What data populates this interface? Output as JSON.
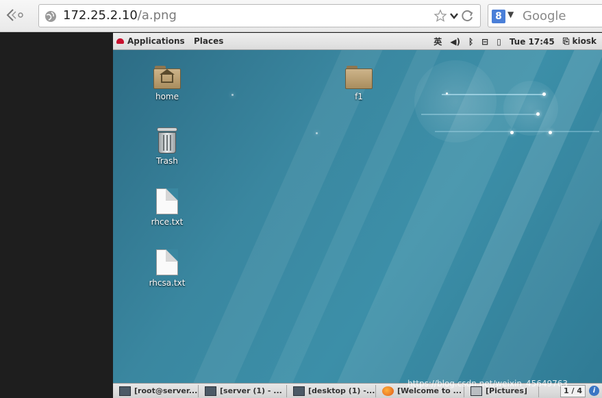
{
  "browser": {
    "url_host": "172.25.2.10",
    "url_path": "/a.png",
    "search_placeholder": "Google",
    "search_engine_letter": "8"
  },
  "remote": {
    "topbar": {
      "applications": "Applications",
      "places": "Places",
      "ime": "英",
      "clock": "Tue 17:45",
      "user": "kiosk"
    },
    "desktop_icons": [
      {
        "label": "home",
        "type": "home-folder"
      },
      {
        "label": "Trash",
        "type": "trash"
      },
      {
        "label": "rhce.txt",
        "type": "text-file"
      },
      {
        "label": "rhcsa.txt",
        "type": "text-file"
      },
      {
        "label": "f1",
        "type": "folder"
      }
    ],
    "taskbar": {
      "items": [
        {
          "label": "[root@server...",
          "icon": "terminal-icon"
        },
        {
          "label": "[server (1) - ...",
          "icon": "vm-icon"
        },
        {
          "label": "[desktop (1) -...",
          "icon": "vm-icon"
        },
        {
          "label": "[Welcome to ...",
          "icon": "firefox-icon"
        },
        {
          "label": "[Pictures]",
          "icon": "folder-icon"
        }
      ],
      "pager": "1 / 4"
    },
    "watermark": "https://blog.csdn.net/weixin_45649763"
  },
  "colors": {
    "wallpaper": "#3a87a0",
    "panel": "#e4e4e4",
    "left_strip": "#1e1e1e"
  }
}
